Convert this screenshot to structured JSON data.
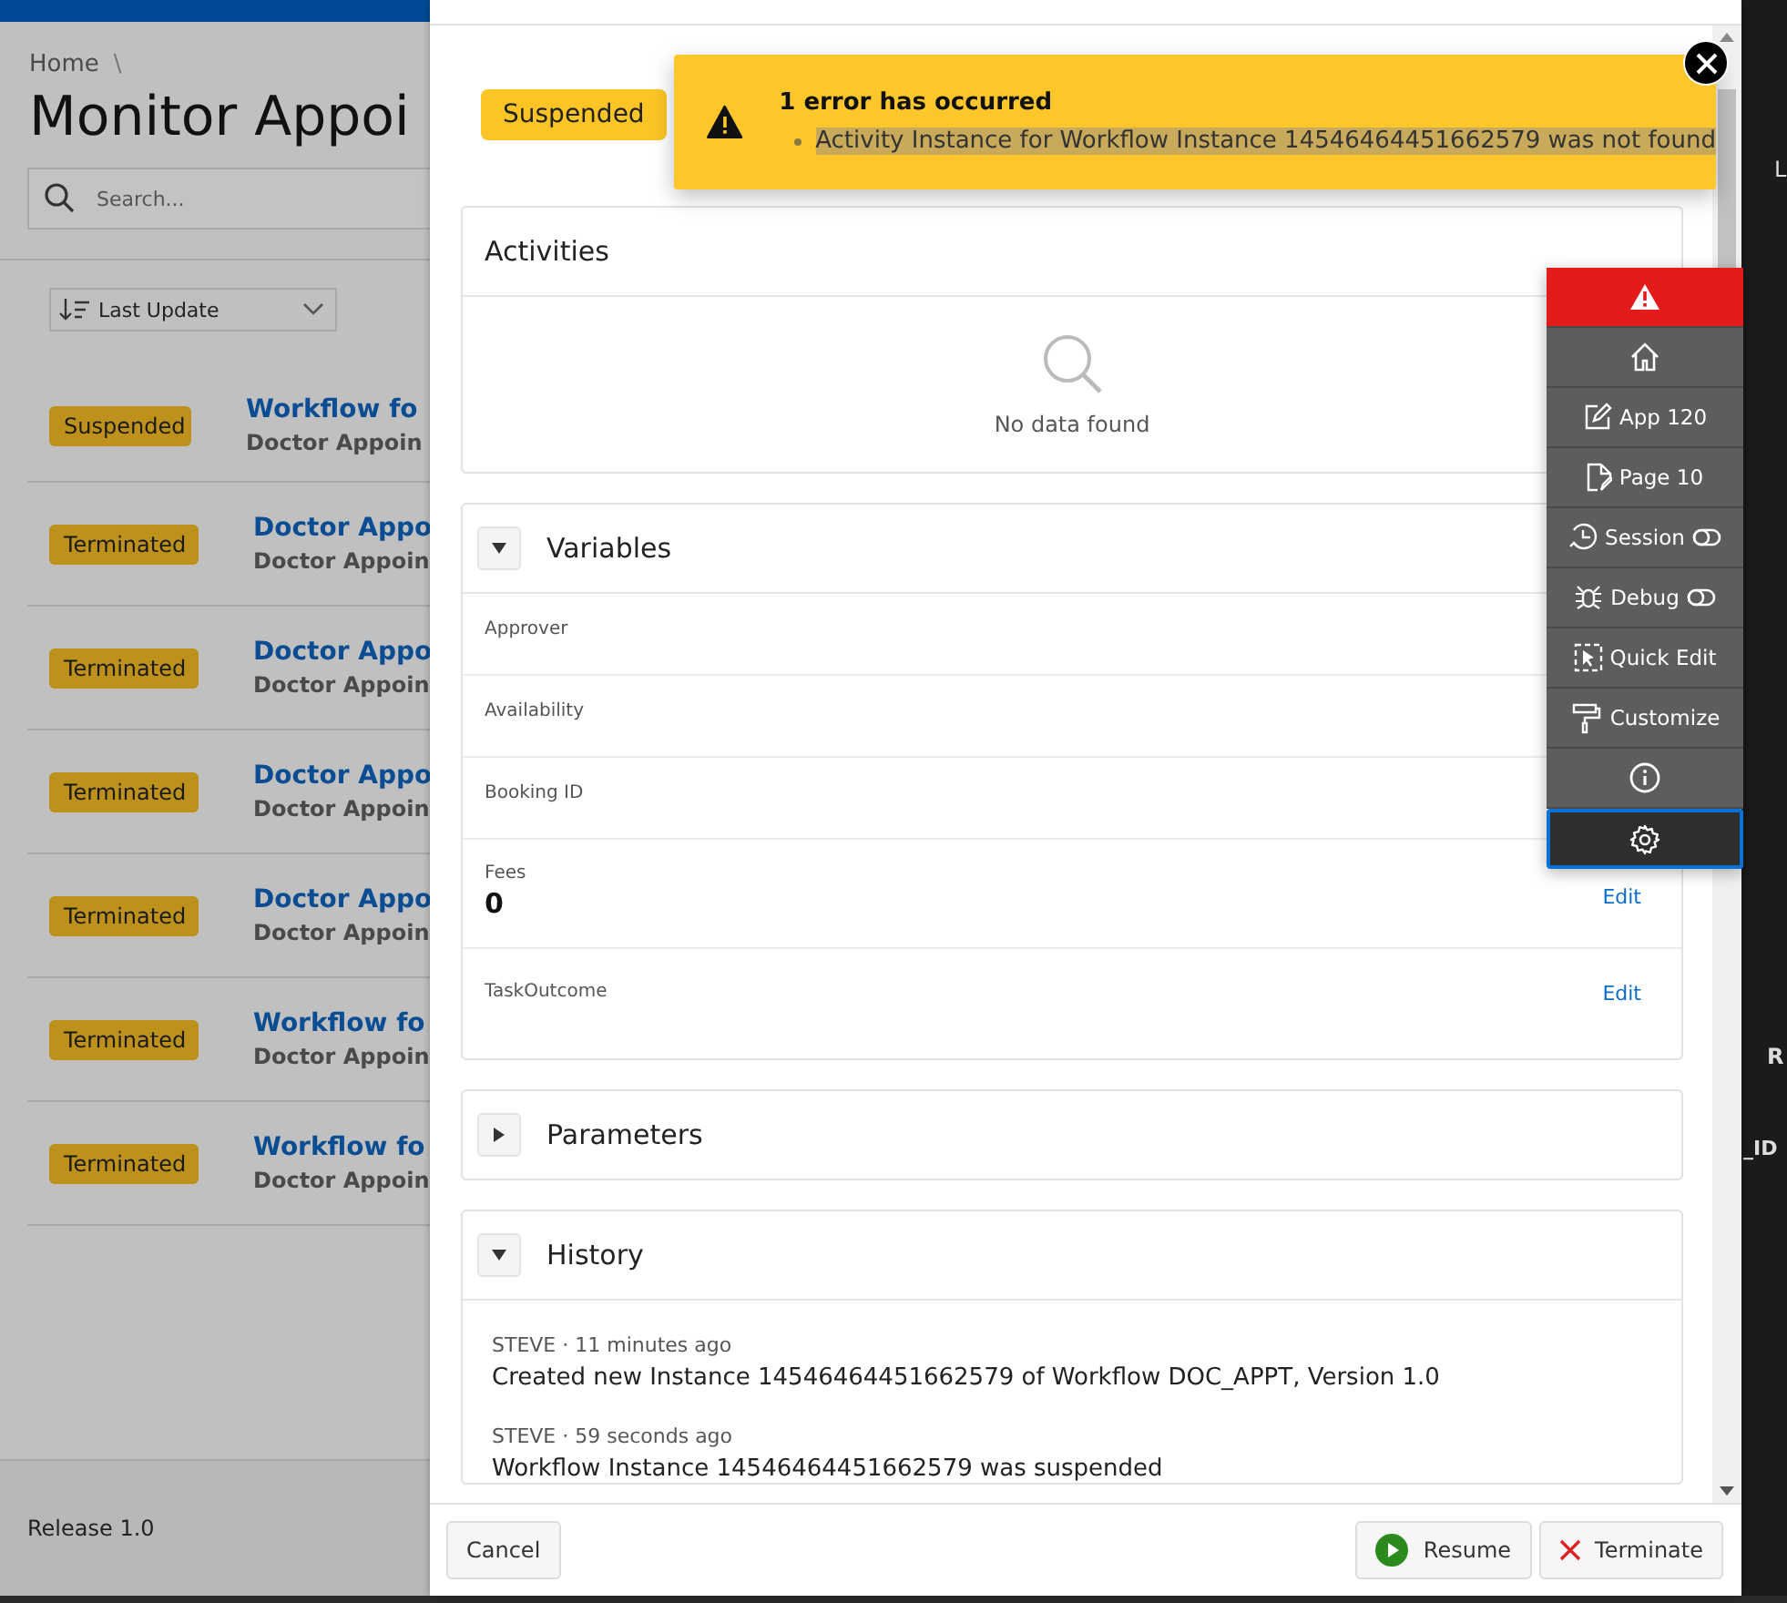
{
  "background_page": {
    "breadcrumb": "Home",
    "breadcrumb_separator": "\\",
    "title": "Monitor Appoi",
    "search": {
      "placeholder": "Search..."
    },
    "sort": {
      "label": "Last Update"
    },
    "rows": [
      {
        "status": "Suspended",
        "title": "Workflow fo",
        "subtitle": "Doctor Appoin"
      },
      {
        "status": "Terminated",
        "title": "Doctor Appo",
        "subtitle": "Doctor Appoin"
      },
      {
        "status": "Terminated",
        "title": "Doctor Appo",
        "subtitle": "Doctor Appoin"
      },
      {
        "status": "Terminated",
        "title": "Doctor Appo",
        "subtitle": "Doctor Appoin"
      },
      {
        "status": "Terminated",
        "title": "Doctor Appo",
        "subtitle": "Doctor Appoin"
      },
      {
        "status": "Terminated",
        "title": "Workflow fo",
        "subtitle": "Doctor Appoin"
      },
      {
        "status": "Terminated",
        "title": "Workflow fo",
        "subtitle": "Doctor Appoin"
      }
    ],
    "footer": "Release 1.0"
  },
  "right_panel": {
    "fragments": [
      "L",
      "R",
      "_ID"
    ]
  },
  "dialog": {
    "status": "Suspended",
    "activities": {
      "title": "Activities",
      "empty_message": "No data found"
    },
    "variables": {
      "title": "Variables",
      "expanded": true,
      "items": [
        {
          "label": "Approver"
        },
        {
          "label": "Availability"
        },
        {
          "label": "Booking ID"
        },
        {
          "label": "Fees",
          "value": "0",
          "action": "Edit"
        },
        {
          "label": "TaskOutcome",
          "action": "Edit"
        }
      ]
    },
    "parameters": {
      "title": "Parameters",
      "expanded": false
    },
    "history": {
      "title": "History",
      "expanded": true,
      "entries": [
        {
          "meta": "STEVE · 11 minutes ago",
          "text": "Created new Instance 14546464451662579 of Workflow DOC_APPT, Version 1.0"
        },
        {
          "meta": "STEVE · 59 seconds ago",
          "text": "Workflow Instance 14546464451662579 was suspended"
        }
      ]
    },
    "buttons": [
      {
        "label": "Cancel",
        "kind": "plain"
      },
      {
        "label": "Resume",
        "kind": "resume"
      },
      {
        "label": "Terminate",
        "kind": "terminate"
      }
    ]
  },
  "error": {
    "title": "1 error has occurred",
    "messages": [
      "Activity Instance for Workflow Instance 14546464451662579 was not found"
    ]
  },
  "dev_toolbar": {
    "items": [
      {
        "kind": "error"
      },
      {
        "kind": "home"
      },
      {
        "kind": "app",
        "label": "App 120"
      },
      {
        "kind": "page",
        "label": "Page 10"
      },
      {
        "kind": "session",
        "label": "Session",
        "toggle": true
      },
      {
        "kind": "debug",
        "label": "Debug",
        "toggle": true
      },
      {
        "kind": "quickedit",
        "label": "Quick Edit"
      },
      {
        "kind": "customize",
        "label": "Customize"
      },
      {
        "kind": "info"
      },
      {
        "kind": "settings",
        "selected": true
      }
    ]
  }
}
